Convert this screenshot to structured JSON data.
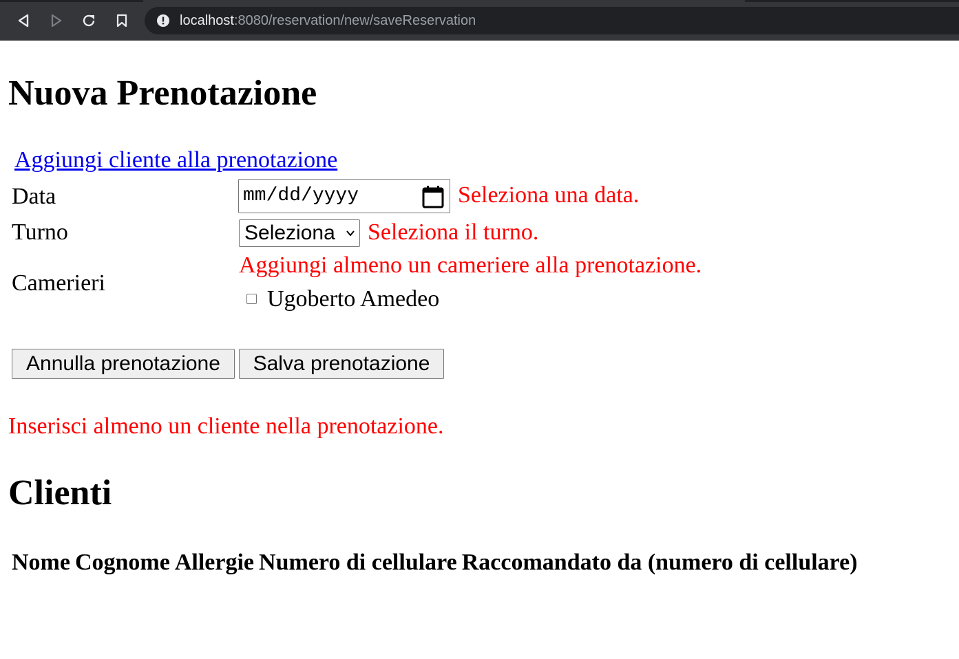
{
  "browser": {
    "url_host": "localhost",
    "url_path": ":8080/reservation/new/saveReservation",
    "buttons": {
      "back": "back-icon",
      "forward": "forward-icon",
      "reload": "reload-icon",
      "bookmark": "bookmark-icon"
    }
  },
  "page": {
    "title": "Nuova Prenotazione",
    "add_client_link": "Aggiungi cliente alla prenotazione",
    "form": {
      "date_label": "Data",
      "date_placeholder": "mm/dd/yyyy",
      "date_error": "Seleziona una data.",
      "shift_label": "Turno",
      "shift_selected": "Seleziona",
      "shift_error": "Seleziona il turno.",
      "waiters_label": "Camerieri",
      "waiters_error": "Aggiungi almeno un cameriere alla prenotazione.",
      "waiters": [
        {
          "name": "Ugoberto Amedeo",
          "checked": false
        }
      ]
    },
    "buttons": {
      "cancel": "Annulla prenotazione",
      "save": "Salva prenotazione"
    },
    "client_error": "Inserisci almeno un cliente nella prenotazione.",
    "clients_section": {
      "title": "Clienti",
      "columns": [
        "Nome",
        "Cognome",
        "Allergie",
        "Numero di cellulare",
        "Raccomandato da (numero di cellulare)"
      ]
    }
  },
  "colors": {
    "error": "#ff0000",
    "link": "#0000ee",
    "browser_chrome": "#35363a",
    "omnibox": "#202124"
  }
}
